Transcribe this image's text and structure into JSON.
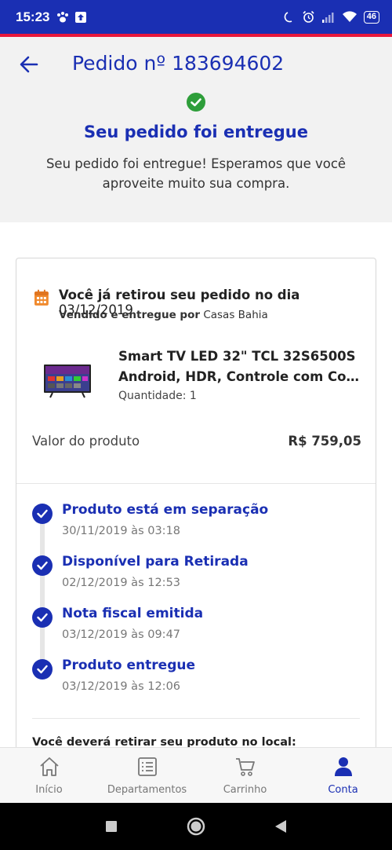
{
  "status_bar": {
    "time": "15:23",
    "battery": "46"
  },
  "header": {
    "order_title": "Pedido nº 183694602",
    "delivered_title": "Seu pedido foi entregue",
    "delivered_subtitle": "Seu pedido foi entregue! Esperamos que você aproveite muito sua compra."
  },
  "order": {
    "pickup_prefix": "Você já retirou seu pedido no dia",
    "pickup_date": "03/12/2019",
    "sold_by_prefix": "Vendido e entregue por",
    "seller": "Casas Bahia",
    "product_name_line1": "Smart TV LED 32\" TCL 32S6500S",
    "product_name_line2": "Android, HDR, Controle com Coma...",
    "quantity": "Quantidade: 1",
    "price_label": "Valor do produto",
    "price_value": "R$ 759,05"
  },
  "timeline": [
    {
      "title": "Produto está em separação",
      "date": "30/11/2019 às 03:18"
    },
    {
      "title": "Disponível para Retirada",
      "date": "02/12/2019 às 12:53"
    },
    {
      "title": "Nota fiscal emitida",
      "date": "03/12/2019 às 09:47"
    },
    {
      "title": "Produto entregue",
      "date": "03/12/2019 às 12:06"
    }
  ],
  "pickup_location_text": "Você deverá retirar seu produto no local:",
  "bottom_nav": {
    "items": [
      {
        "label": "Início",
        "icon": "home-icon"
      },
      {
        "label": "Departamentos",
        "icon": "list-icon"
      },
      {
        "label": "Carrinho",
        "icon": "cart-icon"
      },
      {
        "label": "Conta",
        "icon": "user-icon"
      }
    ],
    "active": "Conta"
  },
  "colors": {
    "primary": "#1a2fb3",
    "accent_red": "#e8173c",
    "success_green": "#2e9e3a",
    "calendar_orange": "#f08a2e"
  }
}
